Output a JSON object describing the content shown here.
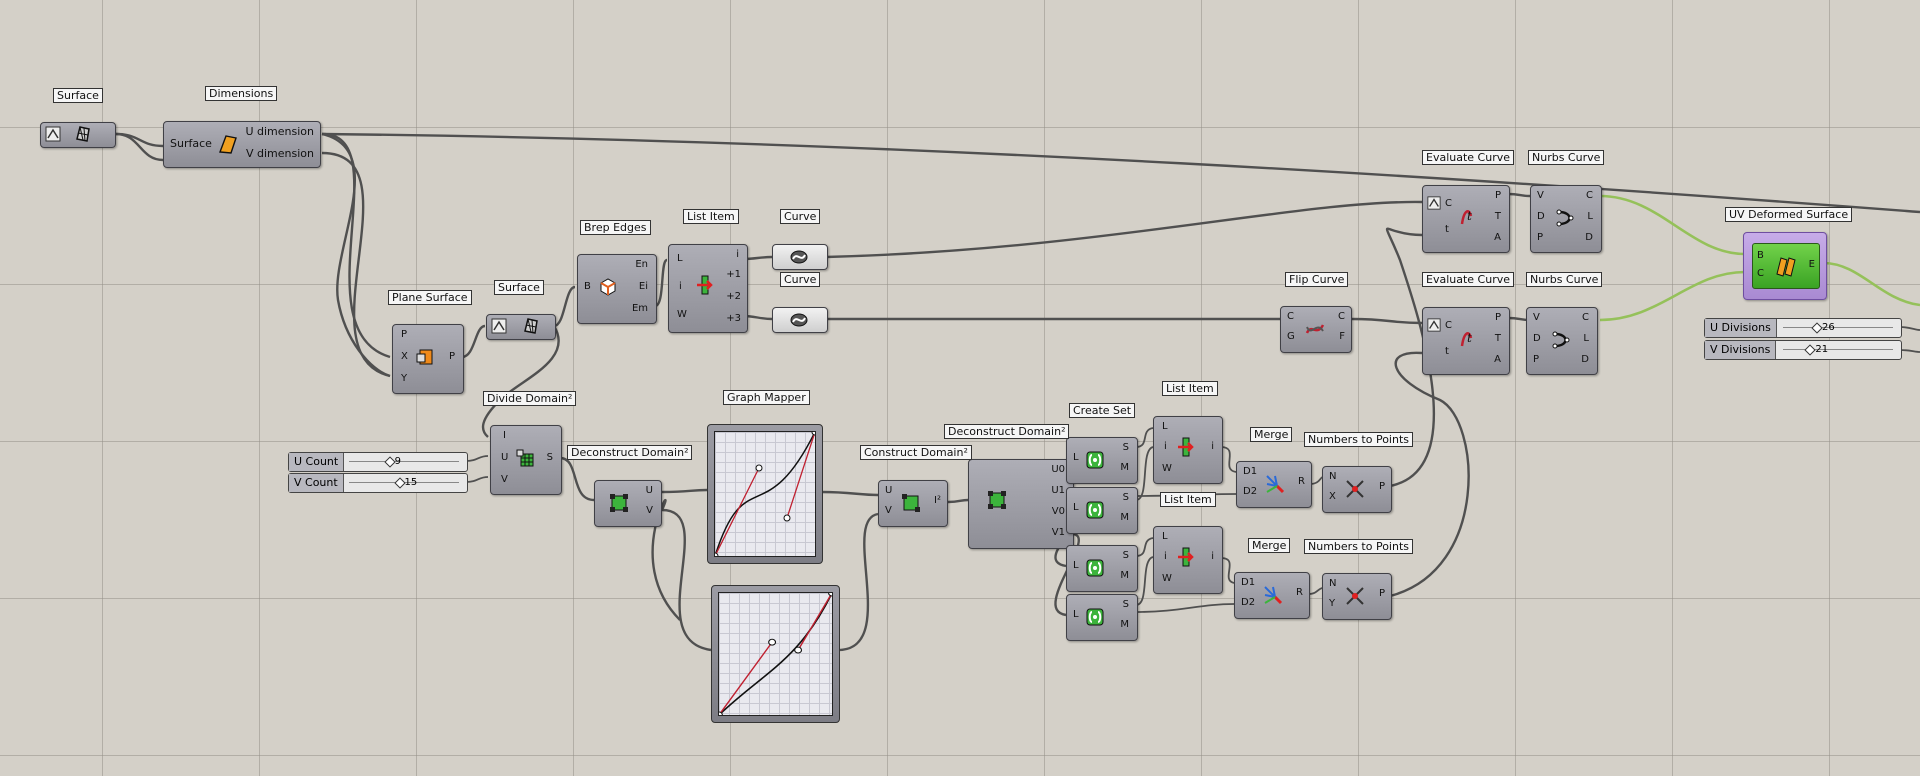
{
  "components": {
    "surface1": {
      "title": "Surface"
    },
    "dimensions": {
      "title": "Dimensions",
      "input": "Surface",
      "out1": "U dimension",
      "out2": "V dimension"
    },
    "plane_surface": {
      "title": "Plane Surface",
      "in": [
        "P",
        "X",
        "Y"
      ],
      "out": "P"
    },
    "surface2": {
      "title": "Surface"
    },
    "brep_edges": {
      "title": "Brep Edges",
      "in": "B",
      "out": [
        "En",
        "Ei",
        "Em"
      ]
    },
    "list_item1": {
      "title": "List Item",
      "in": [
        "L",
        "i",
        "W"
      ],
      "out": [
        "i",
        "+1",
        "+2",
        "+3"
      ]
    },
    "curve1": {
      "title": "Curve"
    },
    "curve2": {
      "title": "Curve"
    },
    "divide_domain": {
      "title": "Divide Domain²",
      "in": [
        "I",
        "U",
        "V"
      ],
      "out": "S"
    },
    "deconstruct_domain1": {
      "title": "Deconstruct Domain²",
      "out": [
        "U",
        "V"
      ]
    },
    "graph_mapper": {
      "title": "Graph Mapper"
    },
    "construct_domain": {
      "title": "Construct Domain²",
      "in": [
        "U",
        "V"
      ],
      "out": "I²"
    },
    "deconstruct_domain2": {
      "title": "Deconstruct Domain²",
      "out": [
        "U0",
        "U1",
        "V0",
        "V1"
      ]
    },
    "create_set": {
      "title": "Create Set",
      "in": "L",
      "out": [
        "S",
        "M"
      ]
    },
    "list_item2": {
      "title": "List Item",
      "in": [
        "L",
        "i",
        "W"
      ],
      "out": "i"
    },
    "list_item3": {
      "title": "List Item",
      "in": [
        "L",
        "i",
        "W"
      ],
      "out": "i"
    },
    "merge1": {
      "title": "Merge",
      "in": [
        "D1",
        "D2"
      ],
      "out": "R"
    },
    "merge2": {
      "title": "Merge",
      "in": [
        "D1",
        "D2"
      ],
      "out": "R"
    },
    "numbers_to_points1": {
      "title": "Numbers to Points",
      "in": [
        "N",
        "X"
      ],
      "out": "P"
    },
    "numbers_to_points2": {
      "title": "Numbers to Points",
      "in": [
        "N",
        "Y"
      ],
      "out": "P"
    },
    "flip_curve": {
      "title": "Flip Curve",
      "in": [
        "C",
        "G"
      ],
      "out": [
        "C",
        "F"
      ]
    },
    "evaluate_curve1": {
      "title": "Evaluate Curve",
      "in": [
        "C",
        "t"
      ],
      "out": [
        "P",
        "T",
        "A"
      ]
    },
    "evaluate_curve2": {
      "title": "Evaluate Curve",
      "in": [
        "C",
        "t"
      ],
      "out": [
        "P",
        "T",
        "A"
      ]
    },
    "nurbs_curve1": {
      "title": "Nurbs Curve",
      "in": [
        "V",
        "D",
        "P"
      ],
      "out": [
        "C",
        "L",
        "D"
      ]
    },
    "nurbs_curve2": {
      "title": "Nurbs Curve",
      "in": [
        "V",
        "D",
        "P"
      ],
      "out": [
        "C",
        "L",
        "D"
      ]
    },
    "uv_deformed": {
      "title": "UV Deformed Surface",
      "in": [
        "B",
        "C"
      ],
      "out": "E"
    }
  },
  "sliders": {
    "u_count": {
      "label": "U Count",
      "value": "9",
      "fraction": 0.36
    },
    "v_count": {
      "label": "V Count",
      "value": "15",
      "fraction": 0.45
    },
    "u_divisions": {
      "label": "U Divisions",
      "value": "26",
      "fraction": 0.3
    },
    "v_divisions": {
      "label": "V Divisions",
      "value": "21",
      "fraction": 0.24
    }
  },
  "colors": {
    "canvas": "#d4d0c8",
    "component": "#9a9aa2",
    "selected": "#b89ce0",
    "wire": "#505050",
    "wire_selected": "#95c15a",
    "icon_green": "#3cb43c",
    "icon_orange": "#f08a1a"
  }
}
